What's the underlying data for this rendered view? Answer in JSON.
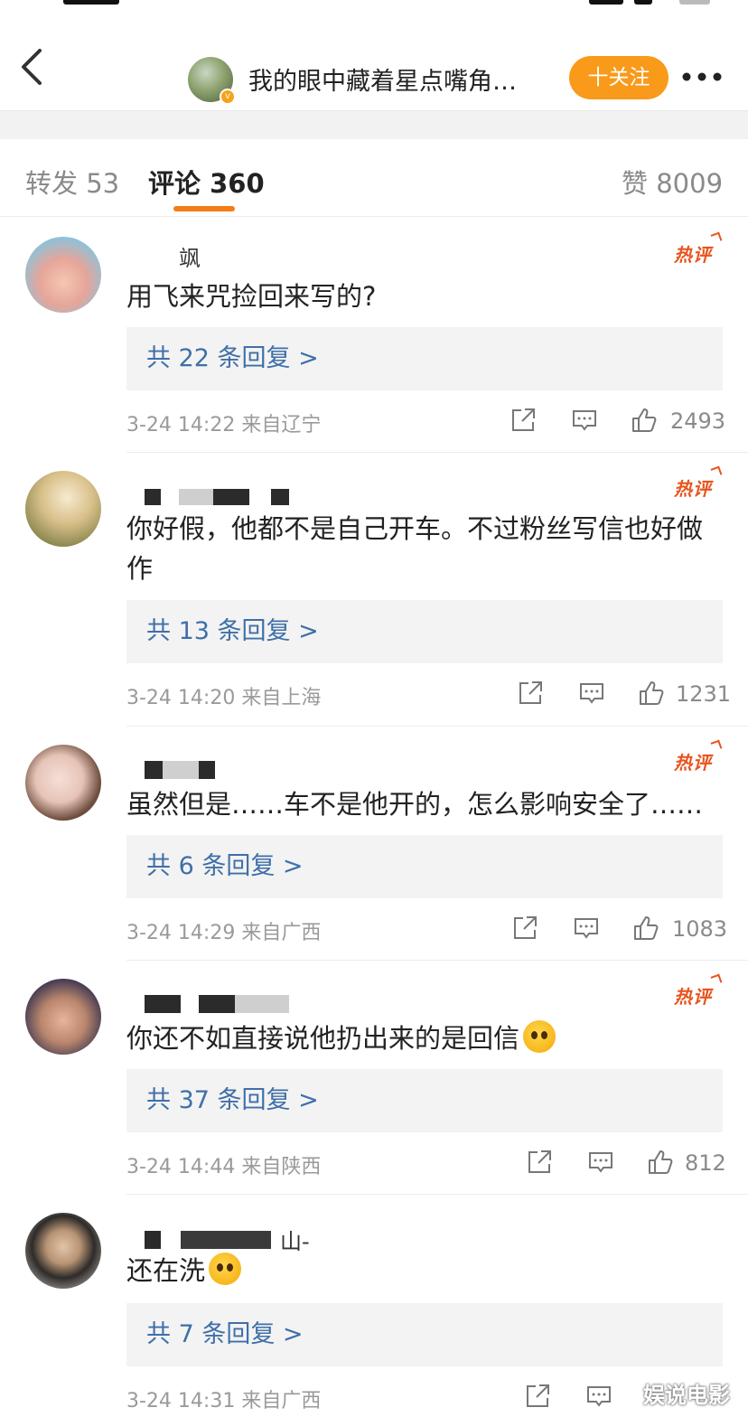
{
  "nav": {
    "title": "我的眼中藏着星点嘴角…",
    "follow_label": "十关注",
    "verified_glyph": "v"
  },
  "tabs": {
    "repost": "转发 53",
    "comments": "评论 360",
    "likes": "赞 8009"
  },
  "hot_label": "热评",
  "comments": [
    {
      "name_fragment": "飒",
      "text": "用飞来咒捡回来写的?",
      "replies": "共 22 条回复 >",
      "date": "3-24 14:22 来自辽宁",
      "likes": "2493"
    },
    {
      "name_fragment": "",
      "text": "你好假，他都不是自己开车。不过粉丝写信也好做作",
      "replies": "共 13 条回复 >",
      "date": "3-24 14:20 来自上海",
      "likes": "1231"
    },
    {
      "name_fragment": "",
      "text": "虽然但是……车不是他开的，怎么影响安全了……",
      "replies": "共 6 条回复 >",
      "date": "3-24 14:29 来自广西",
      "likes": "1083"
    },
    {
      "name_fragment": "",
      "text": "你还不如直接说他扔出来的是回信",
      "replies": "共 37 条回复 >",
      "date": "3-24 14:44 来自陕西",
      "likes": "812"
    },
    {
      "name_fragment": "山-",
      "text": "还在洗",
      "replies": "共 7 条回复 >",
      "date": "3-24 14:31 来自广西",
      "likes": ""
    }
  ],
  "watermark": "娱说电影",
  "colors": {
    "accent": "#f99a1a",
    "tab_underline": "#f57c16",
    "hot": "#e8541e",
    "reply_link": "#3f6fa8"
  },
  "icons": [
    "chevron-left-icon",
    "more-dots-icon",
    "share-icon",
    "comment-icon",
    "thumbs-up-icon",
    "laugh-emoji-icon",
    "cry-laugh-emoji-icon"
  ]
}
